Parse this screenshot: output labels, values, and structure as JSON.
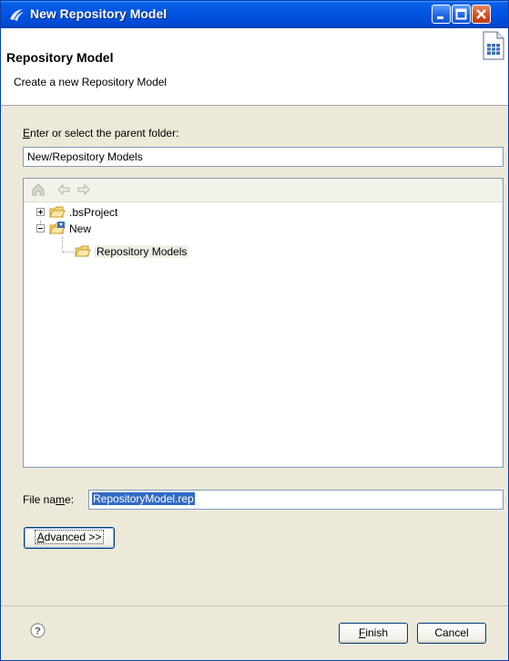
{
  "window": {
    "title": "New Repository Model"
  },
  "header": {
    "title": "Repository Model",
    "description": "Create a new Repository Model"
  },
  "parent_folder": {
    "label_prefix": "",
    "label_mnemonic": "E",
    "label_rest": "nter or select the parent folder:",
    "value": "New/Repository Models"
  },
  "tree": {
    "items": [
      {
        "label": ".bsProject",
        "expander": "plus"
      },
      {
        "label": "New",
        "expander": "minus"
      },
      {
        "label": "Repository Models",
        "selected": true
      }
    ]
  },
  "file_name": {
    "label_prefix": "File na",
    "label_mnemonic": "m",
    "label_rest": "e:",
    "value": "RepositoryModel.rep"
  },
  "buttons": {
    "advanced_mnemonic": "A",
    "advanced_rest": "dvanced >>",
    "finish_mnemonic": "F",
    "finish_rest": "inish",
    "cancel": "Cancel"
  },
  "icons": {
    "app": "eclipse-icon",
    "wizard": "new-file-wizard-icon",
    "home": "home-icon",
    "back": "back-arrow-icon",
    "forward": "forward-arrow-icon",
    "help": "help-icon"
  },
  "colors": {
    "titlebar": "#0054e3",
    "selection": "#316ac5",
    "dialog_bg": "#ece9d8",
    "border": "#7f9db9"
  }
}
